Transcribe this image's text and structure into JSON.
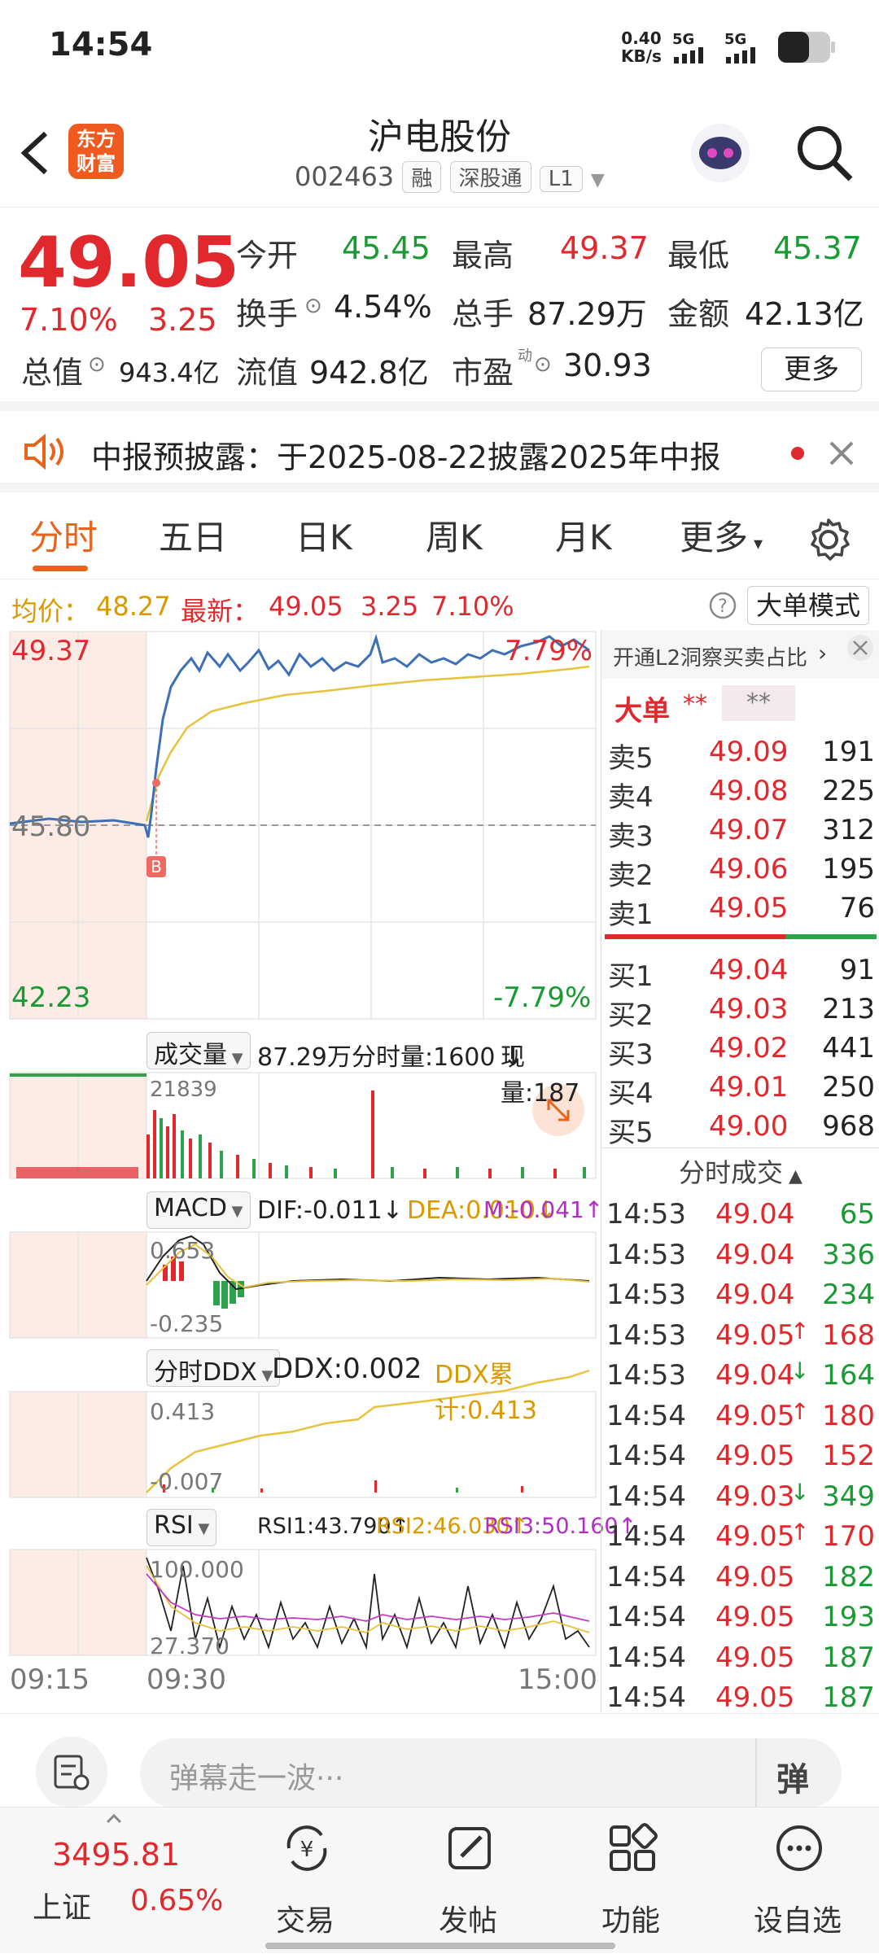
{
  "status": {
    "time": "14:54",
    "speed_value": "0.40",
    "speed_unit": "KB/s",
    "net1": "5G",
    "net2": "5G"
  },
  "header": {
    "title": "沪电股份",
    "code": "002463",
    "tag1": "融",
    "tag2": "深股通",
    "tag3": "L1",
    "logo_line1": "东方",
    "logo_line2": "财富"
  },
  "quote": {
    "price": "49.05",
    "change_pct": "7.10%",
    "change": "3.25",
    "open_label": "今开",
    "open": "45.45",
    "high_label": "最高",
    "high": "49.37",
    "low_label": "最低",
    "low": "45.37",
    "turnover_label": "换手",
    "turnover": "4.54%",
    "vol_label": "总手",
    "vol": "87.29万",
    "amount_label": "金额",
    "amount": "42.13亿",
    "mcap_label": "总值",
    "mcap": "943.4亿",
    "float_label": "流值",
    "float": "942.8亿",
    "pe_label": "市盈",
    "pe_sup": "动",
    "pe": "30.93",
    "more": "更多"
  },
  "notice": {
    "text": "中报预披露：于2025-08-22披露2025年中报"
  },
  "tabs": [
    "分时",
    "五日",
    "日K",
    "周K",
    "月K",
    "更多"
  ],
  "infobar": {
    "avg_label": "均价：",
    "avg": "48.27",
    "latest_label": "最新：",
    "latest": "49.05",
    "chg": "3.25",
    "pct": "7.10%",
    "mode": "大单模式"
  },
  "chart": {
    "ymax": "49.37",
    "ymax_pct": "7.79%",
    "yprev": "45.80",
    "ymin": "42.23",
    "ymin_pct": "-7.79%",
    "marker": "B",
    "vol_title": "成交量",
    "vol_total": "87.29万",
    "vol_unit": "分时量:1600",
    "vol_now": "现量:187",
    "vol_max": "21839",
    "macd_title": "MACD",
    "dif": "DIF:-0.011",
    "dea": "DEA:0.010",
    "m": "M:-0.041",
    "macd_top": "0.653",
    "macd_bot": "-0.235",
    "ddx_title": "分时DDX",
    "ddx": "DDX:0.002",
    "ddx_sum": "DDX累计:0.413",
    "ddx_top": "0.413",
    "ddx_bot": "-0.007",
    "rsi_title": "RSI",
    "rsi1": "RSI1:43.790",
    "rsi2": "RSI2:46.030",
    "rsi3": "RSI3:50.160",
    "rsi_top": "100.000",
    "rsi_bot": "27.370",
    "t1": "09:15",
    "t2": "09:30",
    "t3": "15:00"
  },
  "side": {
    "promo": "开通L2洞察买卖占比",
    "big": "大单",
    "stars1": "**",
    "stars2": "**",
    "sells": [
      {
        "l": "卖5",
        "p": "49.09",
        "v": "191"
      },
      {
        "l": "卖4",
        "p": "49.08",
        "v": "225"
      },
      {
        "l": "卖3",
        "p": "49.07",
        "v": "312"
      },
      {
        "l": "卖2",
        "p": "49.06",
        "v": "195"
      },
      {
        "l": "卖1",
        "p": "49.05",
        "v": "76"
      }
    ],
    "buys": [
      {
        "l": "买1",
        "p": "49.04",
        "v": "91"
      },
      {
        "l": "买2",
        "p": "49.03",
        "v": "213"
      },
      {
        "l": "买3",
        "p": "49.02",
        "v": "441"
      },
      {
        "l": "买4",
        "p": "49.01",
        "v": "250"
      },
      {
        "l": "买5",
        "p": "49.00",
        "v": "968"
      }
    ],
    "trades_title": "分时成交",
    "trades": [
      {
        "t": "14:53",
        "p": "49.04",
        "v": "65",
        "a": "",
        "vc": "green"
      },
      {
        "t": "14:53",
        "p": "49.04",
        "v": "336",
        "a": "",
        "vc": "green"
      },
      {
        "t": "14:53",
        "p": "49.04",
        "v": "234",
        "a": "",
        "vc": "green"
      },
      {
        "t": "14:53",
        "p": "49.05",
        "v": "168",
        "a": "↑",
        "vc": "red"
      },
      {
        "t": "14:53",
        "p": "49.04",
        "v": "164",
        "a": "↓",
        "vc": "green"
      },
      {
        "t": "14:54",
        "p": "49.05",
        "v": "180",
        "a": "↑",
        "vc": "red"
      },
      {
        "t": "14:54",
        "p": "49.05",
        "v": "152",
        "a": "",
        "vc": "red"
      },
      {
        "t": "14:54",
        "p": "49.03",
        "v": "349",
        "a": "↓",
        "vc": "green"
      },
      {
        "t": "14:54",
        "p": "49.05",
        "v": "170",
        "a": "↑",
        "vc": "red"
      },
      {
        "t": "14:54",
        "p": "49.05",
        "v": "182",
        "a": "",
        "vc": "green"
      },
      {
        "t": "14:54",
        "p": "49.05",
        "v": "193",
        "a": "",
        "vc": "green"
      },
      {
        "t": "14:54",
        "p": "49.05",
        "v": "187",
        "a": "",
        "vc": "green"
      },
      {
        "t": "14:54",
        "p": "49.05",
        "v": "187",
        "a": "",
        "vc": "green"
      }
    ]
  },
  "chat": {
    "placeholder": "弹幕走一波···",
    "btn": "弹"
  },
  "bottom": {
    "index_val": "3495.81",
    "index_name": "上证",
    "index_pct": "0.65%",
    "trade": "交易",
    "post": "发帖",
    "func": "功能",
    "watch": "设自选"
  }
}
